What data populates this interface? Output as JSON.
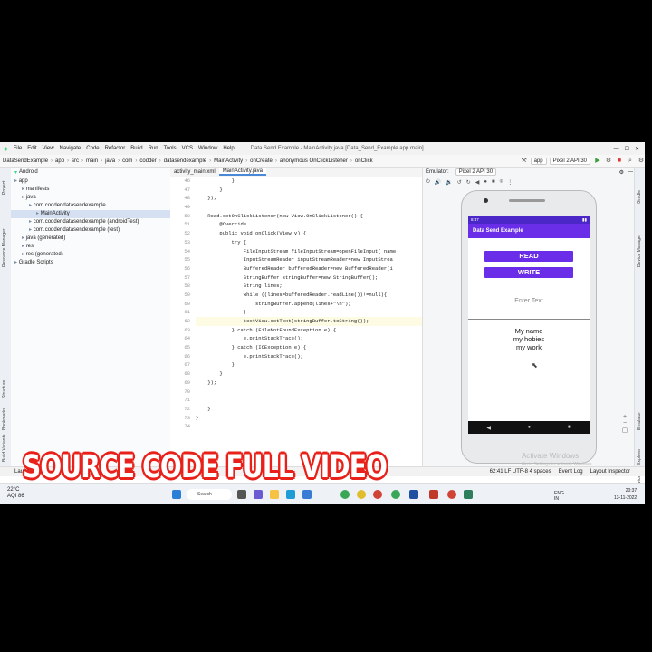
{
  "menu": [
    "File",
    "Edit",
    "View",
    "Navigate",
    "Code",
    "Refactor",
    "Build",
    "Run",
    "Tools",
    "VCS",
    "Window",
    "Help"
  ],
  "window_title": "Data Send Example - MainActivity.java [Data_Send_Example.app.main]",
  "breadcrumb": [
    "DataSendExample",
    "app",
    "src",
    "main",
    "java",
    "com",
    "codder",
    "datasendexample",
    "MainActivity",
    "onCreate",
    "anonymous OnClickListener",
    "onClick"
  ],
  "run_config": "app",
  "device": "Pixel 2 API 30",
  "project_view": "Android",
  "tree": [
    {
      "label": "app",
      "depth": 0
    },
    {
      "label": "manifests",
      "depth": 1
    },
    {
      "label": "java",
      "depth": 1
    },
    {
      "label": "com.codder.datasendexample",
      "depth": 2
    },
    {
      "label": "MainActivity",
      "depth": 3,
      "selected": true
    },
    {
      "label": "com.codder.datasendexample (androidTest)",
      "depth": 2
    },
    {
      "label": "com.codder.datasendexample (test)",
      "depth": 2
    },
    {
      "label": "java (generated)",
      "depth": 1
    },
    {
      "label": "res",
      "depth": 1
    },
    {
      "label": "res (generated)",
      "depth": 1
    },
    {
      "label": "Gradle Scripts",
      "depth": 0
    }
  ],
  "editor_tabs": [
    "activity_main.xml",
    "MainActivity.java"
  ],
  "line_numbers": [
    "46",
    "47",
    "48",
    "49",
    "50",
    "51",
    "52",
    "53",
    "54",
    "55",
    "56",
    "57",
    "58",
    "59",
    "60",
    "61",
    "62",
    "63",
    "64",
    "65",
    "66",
    "67",
    "68",
    "69",
    "70",
    "71",
    "72",
    "73",
    "74"
  ],
  "code_lines": [
    "            }",
    "        }",
    "    });",
    "",
    "    Read.setOnClickListener(new View.OnClickListener() {",
    "        @Override",
    "        public void onClick(View v) {",
    "            try {",
    "                FileInputStream fileInputStream=openFileInput( name",
    "                InputStreamReader inputStreamReader=new InputStrea",
    "                BufferedReader bufferedReader=new BufferedReader(i",
    "                StringBuffer stringBuffer=new StringBuffer();",
    "                String lines;",
    "                while ((lines=bufferedReader.readLine())!=null){",
    "                    stringBuffer.append(lines+\"\\n\");",
    "                }",
    "                textView.setText(stringBuffer.toString());",
    "            } catch (FileNotFoundException e) {",
    "                e.printStackTrace();",
    "            } catch (IOException e) {",
    "                e.printStackTrace();",
    "            }",
    "        }",
    "    });",
    "",
    "",
    "    }",
    "}",
    ""
  ],
  "emulator_label": "Emulator:",
  "emulator_tab": "Pixel 2 API 30",
  "app": {
    "status_time": "8:37",
    "title": "Data Send Example",
    "read_button": "READ",
    "write_button": "WRITE",
    "input_placeholder": "Enter Text",
    "output_lines": [
      "My name",
      "my hobies",
      "my work"
    ]
  },
  "statusline": {
    "left": "Launch",
    "event_log": "Event Log",
    "layout_inspector": "Layout Inspector",
    "position": "62:41  LF  UTF-8  4 spaces"
  },
  "taskbar": {
    "weather_temp": "22°C",
    "weather_desc": "AQI 86",
    "search": "Search",
    "lang": "ENG IN",
    "time": "20:37",
    "date": "13-11-2022"
  },
  "banner": "SOURCE CODE FULL VIDEO",
  "watermark": {
    "line1": "Activate Windows",
    "line2": "Go to Settings to activate Windows."
  },
  "side_labels": {
    "project": "Project",
    "resource_manager": "Resource Manager",
    "structure": "Structure",
    "bookmarks": "Bookmarks",
    "build_variants": "Build Variants",
    "gradle": "Gradle",
    "device_manager": "Device Manager",
    "emulator": "Emulator",
    "device_file_explorer": "Device File Explorer"
  }
}
